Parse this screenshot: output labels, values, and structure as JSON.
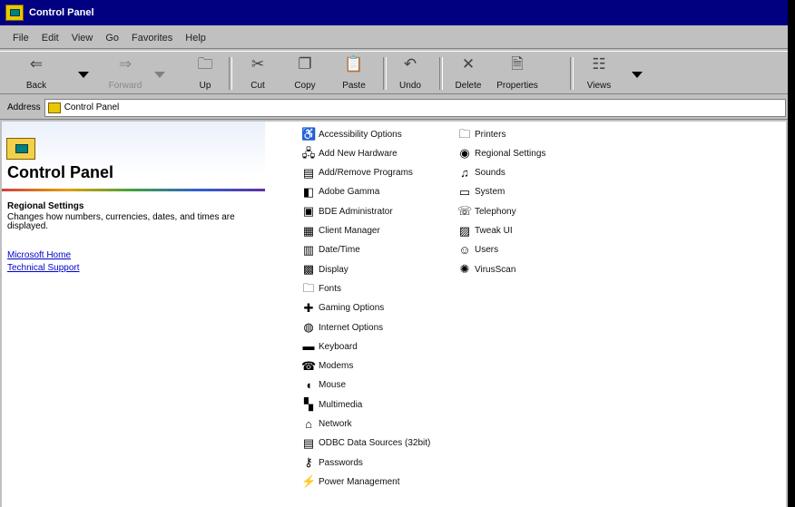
{
  "window": {
    "title": "Control Panel"
  },
  "menu": [
    "File",
    "Edit",
    "View",
    "Go",
    "Favorites",
    "Help"
  ],
  "toolbar": [
    {
      "id": "back",
      "label": "Back",
      "glyph": "⇐",
      "disabled": false
    },
    {
      "id": "forward",
      "label": "Forward",
      "glyph": "⇒",
      "disabled": true
    },
    {
      "id": "up",
      "label": "Up",
      "glyph": "🗀",
      "disabled": false
    },
    {
      "id": "cut",
      "label": "Cut",
      "glyph": "✂",
      "disabled": false
    },
    {
      "id": "copy",
      "label": "Copy",
      "glyph": "❐",
      "disabled": false
    },
    {
      "id": "paste",
      "label": "Paste",
      "glyph": "📋",
      "disabled": false
    },
    {
      "id": "undo",
      "label": "Undo",
      "glyph": "↶",
      "disabled": false
    },
    {
      "id": "delete",
      "label": "Delete",
      "glyph": "✕",
      "disabled": false
    },
    {
      "id": "properties",
      "label": "Properties",
      "glyph": "🗎",
      "disabled": false
    },
    {
      "id": "views",
      "label": "Views",
      "glyph": "☷",
      "disabled": false
    }
  ],
  "address": {
    "label": "Address",
    "value": "Control Panel"
  },
  "panel": {
    "title": "Control Panel",
    "section_title": "Regional Settings",
    "section_text": "Changes how numbers, currencies, dates, and times are displayed.",
    "links": [
      "Microsoft Home",
      "Technical Support"
    ]
  },
  "items_col1": [
    {
      "name": "Accessibility Options",
      "icon": "♿"
    },
    {
      "name": "Add New Hardware",
      "icon": "🖧"
    },
    {
      "name": "Add/Remove Programs",
      "icon": "▤"
    },
    {
      "name": "Adobe Gamma",
      "icon": "◧"
    },
    {
      "name": "BDE Administrator",
      "icon": "▣"
    },
    {
      "name": "Client Manager",
      "icon": "▦"
    },
    {
      "name": "Date/Time",
      "icon": "▥"
    },
    {
      "name": "Display",
      "icon": "▩"
    },
    {
      "name": "Fonts",
      "icon": "🗀"
    },
    {
      "name": "Gaming Options",
      "icon": "✚"
    },
    {
      "name": "Internet Options",
      "icon": "◍"
    },
    {
      "name": "Keyboard",
      "icon": "▬"
    },
    {
      "name": "Modems",
      "icon": "☎"
    },
    {
      "name": "Mouse",
      "icon": "◖"
    },
    {
      "name": "Multimedia",
      "icon": "▚"
    },
    {
      "name": "Network",
      "icon": "⌂"
    },
    {
      "name": "ODBC Data Sources (32bit)",
      "icon": "▤"
    },
    {
      "name": "Passwords",
      "icon": "⚷"
    },
    {
      "name": "Power Management",
      "icon": "⚡"
    }
  ],
  "items_col2": [
    {
      "name": "Printers",
      "icon": "🗀"
    },
    {
      "name": "Regional Settings",
      "icon": "◉"
    },
    {
      "name": "Sounds",
      "icon": "♫"
    },
    {
      "name": "System",
      "icon": "▭"
    },
    {
      "name": "Telephony",
      "icon": "☏"
    },
    {
      "name": "Tweak UI",
      "icon": "▨"
    },
    {
      "name": "Users",
      "icon": "☺"
    },
    {
      "name": "VirusScan",
      "icon": "✺"
    }
  ]
}
